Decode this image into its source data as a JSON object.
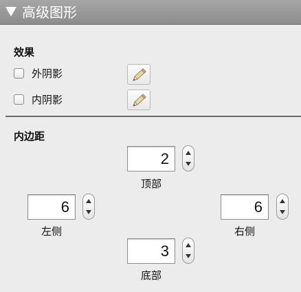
{
  "header": {
    "title": "高级图形"
  },
  "effects": {
    "section_title": "效果",
    "outer_shadow_label": "外阴影",
    "inner_shadow_label": "内阴影",
    "outer_shadow_checked": false,
    "inner_shadow_checked": false
  },
  "padding": {
    "section_title": "内边距",
    "top": {
      "label": "顶部",
      "value": "2"
    },
    "left": {
      "label": "左侧",
      "value": "6"
    },
    "right": {
      "label": "右侧",
      "value": "6"
    },
    "bottom": {
      "label": "底部",
      "value": "3"
    }
  },
  "icons": {
    "disclosure": "disclosure-triangle-icon",
    "edit": "pencil-icon",
    "stepper_up": "chevron-up-icon",
    "stepper_down": "chevron-down-icon"
  }
}
